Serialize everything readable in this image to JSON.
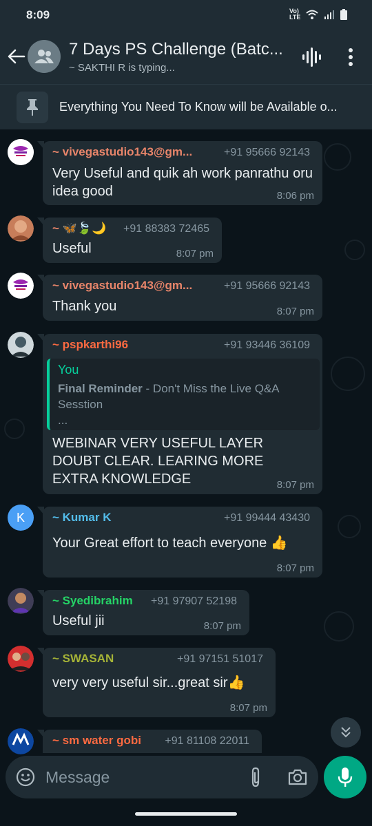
{
  "status_bar": {
    "time": "8:09",
    "network_label": "Vo) LTE"
  },
  "header": {
    "title": "7 Days PS Challenge (Batc...",
    "subtitle": "~ SAKTHI R is typing..."
  },
  "pinned": {
    "text": "Everything You Need To Know will be Available o..."
  },
  "messages": [
    {
      "sender": "~ vivegastudio143@gm...",
      "sender_color": "#e8856a",
      "phone": "+91 95666 92143",
      "text": "Very Useful and quik ah work panrathu oru idea good",
      "time": "8:06 pm"
    },
    {
      "sender": "~ 🦋🍃🌙",
      "sender_color": "#e8856a",
      "phone": "+91 88383 72465",
      "text": "Useful",
      "time": "8:07 pm"
    },
    {
      "sender": "~ vivegastudio143@gm...",
      "sender_color": "#e8856a",
      "phone": "+91 95666 92143",
      "text": "Thank you",
      "time": "8:07 pm"
    },
    {
      "sender": "~ pspkarthi96",
      "sender_color": "#fc6a41",
      "phone": "+91 93446 36109",
      "quote": {
        "author": "You",
        "title": "Final Reminder",
        "text": " - Don't Miss the Live Q&A Sesstion",
        "more": "..."
      },
      "text": "WEBINAR VERY USEFUL  LAYER DOUBT CLEAR. LEARING MORE EXTRA KNOWLEDGE",
      "time": "8:07 pm"
    },
    {
      "sender": "~ Kumar K",
      "sender_color": "#53bdeb",
      "phone": "+91 99444 43430",
      "avatar_letter": "K",
      "text": "Your Great effort to teach everyone 👍",
      "time": "8:07 pm"
    },
    {
      "sender": "~ Syedibrahim",
      "sender_color": "#25d366",
      "phone": "+91 97907 52198",
      "text": "Useful jii",
      "time": "8:07 pm"
    },
    {
      "sender": "~ SWASAN",
      "sender_color": "#a5b337",
      "phone": "+91 97151 51017",
      "text": "very very useful sir...great sir👍",
      "time": "8:07 pm"
    },
    {
      "sender": "~ sm water gobi",
      "sender_color": "#fc6a41",
      "phone": "+91 81108 22011"
    }
  ],
  "composer": {
    "placeholder": "Message"
  },
  "colors": {
    "accent": "#00a884",
    "bubble": "#202c33",
    "background": "#0b141a",
    "header": "#1f2c34"
  },
  "icons": [
    "back-arrow-icon",
    "group-icon",
    "voice-wave-icon",
    "more-vert-icon",
    "pin-icon",
    "emoji-icon",
    "paperclip-icon",
    "camera-icon",
    "mic-icon",
    "chevron-double-down-icon"
  ]
}
